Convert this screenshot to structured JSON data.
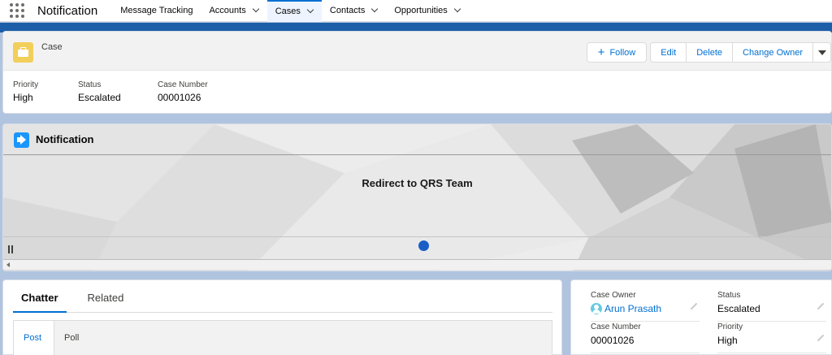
{
  "nav": {
    "app_name": "Notification",
    "items": [
      {
        "label": "Message Tracking",
        "dropdown": false,
        "active": false
      },
      {
        "label": "Accounts",
        "dropdown": true,
        "active": false
      },
      {
        "label": "Cases",
        "dropdown": true,
        "active": true
      },
      {
        "label": "Contacts",
        "dropdown": true,
        "active": false
      },
      {
        "label": "Opportunities",
        "dropdown": true,
        "active": false
      }
    ]
  },
  "record": {
    "object_label": "Case",
    "actions": {
      "follow": "Follow",
      "edit": "Edit",
      "delete": "Delete",
      "change_owner": "Change Owner"
    },
    "highlights": [
      {
        "label": "Priority",
        "value": "High"
      },
      {
        "label": "Status",
        "value": "Escalated"
      },
      {
        "label": "Case Number",
        "value": "00001026"
      }
    ]
  },
  "notification": {
    "title": "Notification",
    "message": "Redirect to QRS Team",
    "icon": "megaphone-icon",
    "accent": "#1b5fc6"
  },
  "chatter": {
    "tabs": [
      "Chatter",
      "Related"
    ],
    "publisher_tabs": [
      "Post",
      "Poll"
    ]
  },
  "details": {
    "case_owner_label": "Case Owner",
    "case_owner": "Arun Prasath",
    "status_label": "Status",
    "status": "Escalated",
    "case_number_label": "Case Number",
    "case_number": "00001026",
    "priority_label": "Priority",
    "priority": "High"
  },
  "colors": {
    "brand": "#0070d2",
    "band": "#1c5ea8",
    "case_icon": "#f2cf5b"
  }
}
